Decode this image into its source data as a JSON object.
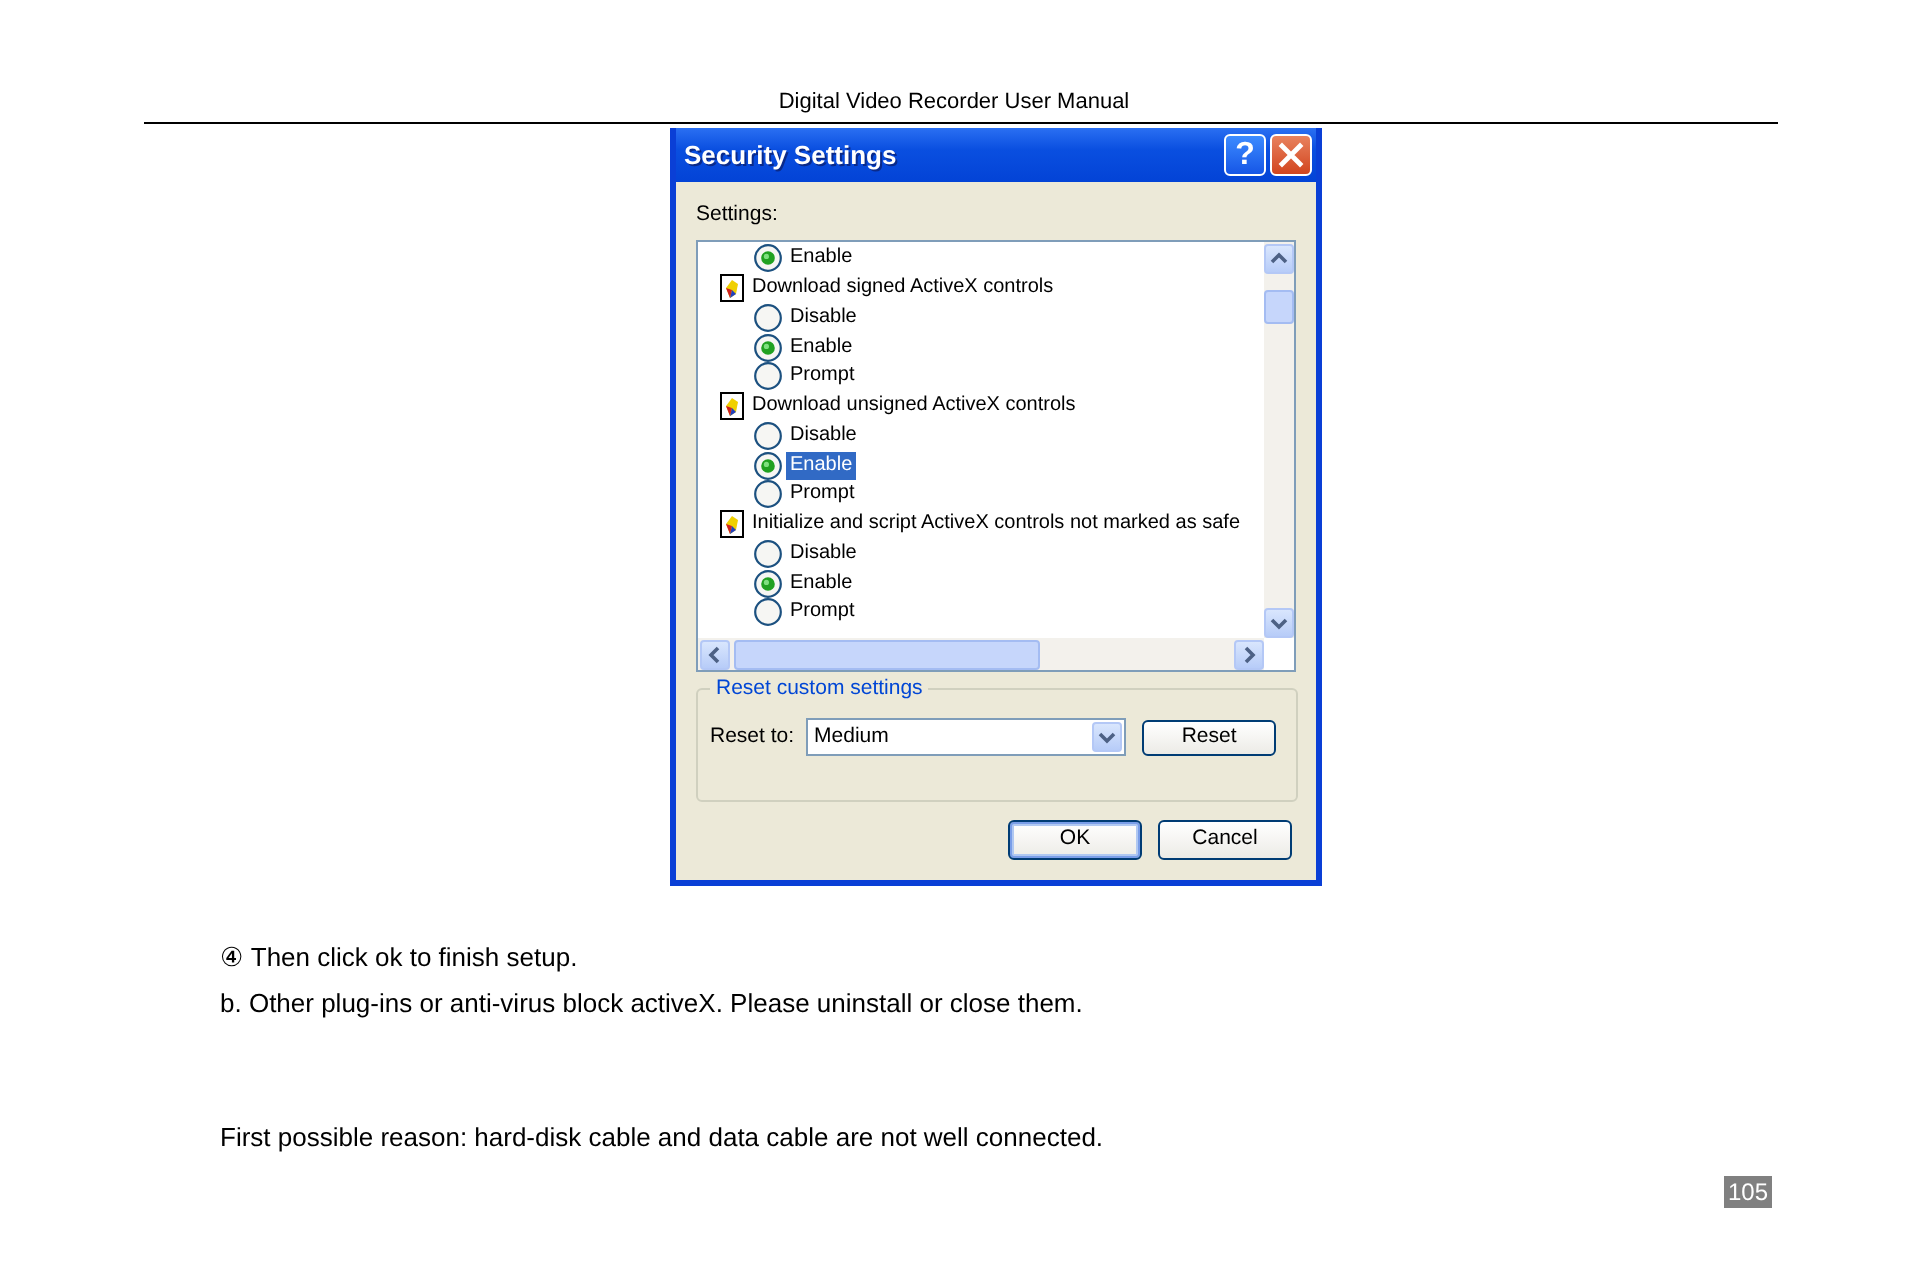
{
  "header": "Digital Video Recorder User Manual",
  "dialog": {
    "title": "Security Settings",
    "help_button": "?",
    "settings_label": "Settings:",
    "settings": [
      {
        "kind": "option",
        "label": "Enable",
        "selected": true,
        "highlighted": false
      },
      {
        "kind": "group",
        "label": "Download signed ActiveX controls"
      },
      {
        "kind": "option",
        "label": "Disable",
        "selected": false,
        "highlighted": false
      },
      {
        "kind": "option",
        "label": "Enable",
        "selected": true,
        "highlighted": false
      },
      {
        "kind": "option",
        "label": "Prompt",
        "selected": false,
        "highlighted": false
      },
      {
        "kind": "group",
        "label": "Download unsigned ActiveX controls"
      },
      {
        "kind": "option",
        "label": "Disable",
        "selected": false,
        "highlighted": false
      },
      {
        "kind": "option",
        "label": "Enable",
        "selected": true,
        "highlighted": true
      },
      {
        "kind": "option",
        "label": "Prompt",
        "selected": false,
        "highlighted": false
      },
      {
        "kind": "group",
        "label": "Initialize and script ActiveX controls not marked as safe"
      },
      {
        "kind": "option",
        "label": "Disable",
        "selected": false,
        "highlighted": false
      },
      {
        "kind": "option",
        "label": "Enable",
        "selected": true,
        "highlighted": false
      },
      {
        "kind": "option",
        "label": "Prompt",
        "selected": false,
        "highlighted": false
      }
    ],
    "reset_group": {
      "legend": "Reset custom settings",
      "label": "Reset to:",
      "value": "Medium",
      "button": "Reset"
    },
    "buttons": [
      {
        "label": "OK",
        "default": true
      },
      {
        "label": "Cancel",
        "default": false
      }
    ]
  },
  "paragraphs": [
    "④  Then click ok to finish setup.",
    "b. Other plug-ins or anti-virus block activeX. Please uninstall or close them.",
    "First possible reason: hard-disk cable and data cable are not well connected."
  ],
  "page_number": "105"
}
